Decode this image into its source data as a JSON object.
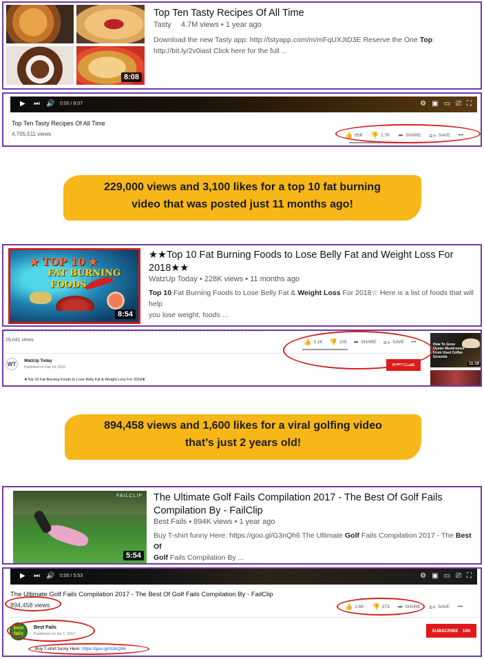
{
  "result1": {
    "title": "Top Ten Tasty Recipes Of All Time",
    "channel": "Tasty",
    "meta": "4.7M views • 1 year ago",
    "desc_line1_pre": "Download the new Tasty app: http://tstyapp.com/m/mFqUXJtD3E Reserve the One ",
    "desc_line1_bold": "Top",
    "desc_line1_post": ":",
    "desc_line2": "http://bit.ly/2v0iast Click here for the full ...",
    "duration": "8:08"
  },
  "player1": {
    "time": "0:00 / 8:07",
    "title": "Top Ten Tasty Recipes Of All Time",
    "views": "4,705,511 views",
    "likes": "85K",
    "dislikes": "1.7K",
    "share": "SHARE",
    "save": "SAVE",
    "more": "•••"
  },
  "banner1": {
    "line1": "229,000 views and 3,100 likes for a top 10 fat burning",
    "line2": "video that was posted just 11 months ago!"
  },
  "result2": {
    "title_line1": "★★Top 10 Fat Burning Foods to Lose Belly Fat and Weight Loss For",
    "title_line2": "2018★★",
    "meta": "WatzUp Today • 228K views • 11 months ago",
    "desc_bold1": "Top 10",
    "desc_mid": " Fat Burning Foods to Lose Belly Fat & ",
    "desc_bold2": "Weight Loss",
    "desc_post": " For 2018☆ Here is a list of foods that will help",
    "desc_line2": "you lose weight, foods ...",
    "duration": "8:54",
    "thumb_text1": "★ TOP 10 ★",
    "thumb_text2": "FAT BURNING",
    "thumb_text3": "FOODS"
  },
  "player2": {
    "views": "29,041 views",
    "likes": "3.1K",
    "dislikes": "105",
    "share": "SHARE",
    "save": "SAVE",
    "more": "•••",
    "channel": "WatzUp Today",
    "published": "Published on Feb 14, 2018",
    "subscribe": "SUBSCRIBE",
    "desc": "★Top 10 Fat Burning Foods to Lose Belly Fat & Weight Loss For 2018★",
    "avatar": "WT",
    "side_video_text": "How To Grow Oyster Mushrooms From Used Coffee Grounds",
    "side_duration": "11:19"
  },
  "banner2": {
    "line1": "894,458 views and 1,600 likes for a viral golfing video",
    "line2": "that’s just 2 years old!"
  },
  "result3": {
    "title_line1": "The Ultimate Golf Fails Compilation 2017 - The Best Of Golf Fails",
    "title_line2": "Compilation By - FailClip",
    "meta": "Best Fails • 894K views • 1 year ago",
    "desc_pre": "Buy T-shirt funny Here: https://goo.gl/G3nQh6 The Ultimate ",
    "desc_bold1": "Golf",
    "desc_mid": " Fails Compilation 2017 - The ",
    "desc_bold2": "Best Of",
    "desc_bold3": "Golf",
    "desc_line2_post": " Fails Compilation By ...",
    "duration": "5:54",
    "thumb_watermark": "FAILCLIP"
  },
  "player3": {
    "time": "0:00 / 5:53",
    "title": "The Ultimate Golf Fails Compilation 2017 - The Best Of Golf Fails Compilation By - FailClip",
    "views": "894,458 views",
    "likes": "1.6K",
    "dislikes": "273",
    "share": "SHARE",
    "save": "SAVE",
    "more": "•••",
    "channel": "Best Fails",
    "published": "Published on Jul 7, 2017",
    "subscribe": "SUBSCRIBE",
    "sub_count": "10K",
    "desc_pre": "Buy T-shirt funny Here: ",
    "desc_link": "https://goo.gl/G3nQh6",
    "avatar_text1": "best",
    "avatar_text2": "fails"
  },
  "colors": {
    "frame": "#6a3aa5",
    "highlight": "#d3201c",
    "banner": "#f7b718",
    "subscribe": "#e01a1a"
  }
}
